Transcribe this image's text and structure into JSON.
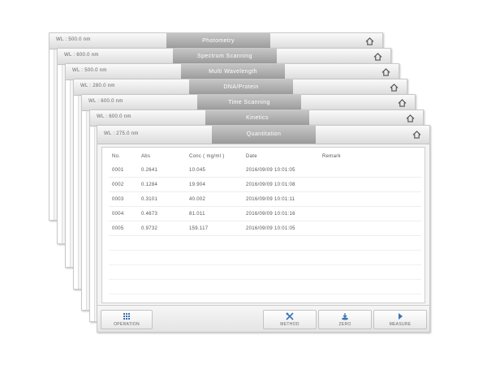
{
  "windows": [
    {
      "wl": "WL : 500.0 nm",
      "title": "Photometry"
    },
    {
      "wl": "WL : 600.0 nm",
      "title": "Spectrum Scanning"
    },
    {
      "wl": "WL : 500.0 nm",
      "title": "Multi Wavelength"
    },
    {
      "wl": "WL : 280.0 nm",
      "title": "DNA/Protein"
    },
    {
      "wl": "WL : 600.0 nm",
      "title": "Time Scanning"
    },
    {
      "wl": "WL : 600.0 nm",
      "title": "Kinetics"
    }
  ],
  "main": {
    "wl": "WL : 275.0 nm",
    "title": "Quantitation",
    "columns": [
      "No.",
      "Abs",
      "Conc ( mg/ml )",
      "Date",
      "Remark"
    ],
    "rows": [
      [
        "0001",
        "0.2641",
        "10.045",
        "2016/09/09 10:01:05",
        ""
      ],
      [
        "0002",
        "0.1284",
        "19.904",
        "2016/09/09 10:01:08",
        ""
      ],
      [
        "0003",
        "0.3101",
        "40.002",
        "2016/09/09 10:01:11",
        ""
      ],
      [
        "0004",
        "0.4673",
        "81.011",
        "2016/09/09 10:01:16",
        ""
      ],
      [
        "0005",
        "0.9732",
        "159.117",
        "2016/09/09 10:01:05",
        ""
      ]
    ],
    "footer": {
      "operation": "OPERATION",
      "method": "METHOD",
      "zero": "ZERO",
      "measure": "MEASURE"
    }
  },
  "colors": {
    "title_tab": "#a8a8a8",
    "background": "#ffffff"
  },
  "icons": {
    "home": "home-icon",
    "operation": "grid-icon",
    "method": "tools-icon",
    "zero": "zero-icon",
    "measure": "play-icon"
  }
}
